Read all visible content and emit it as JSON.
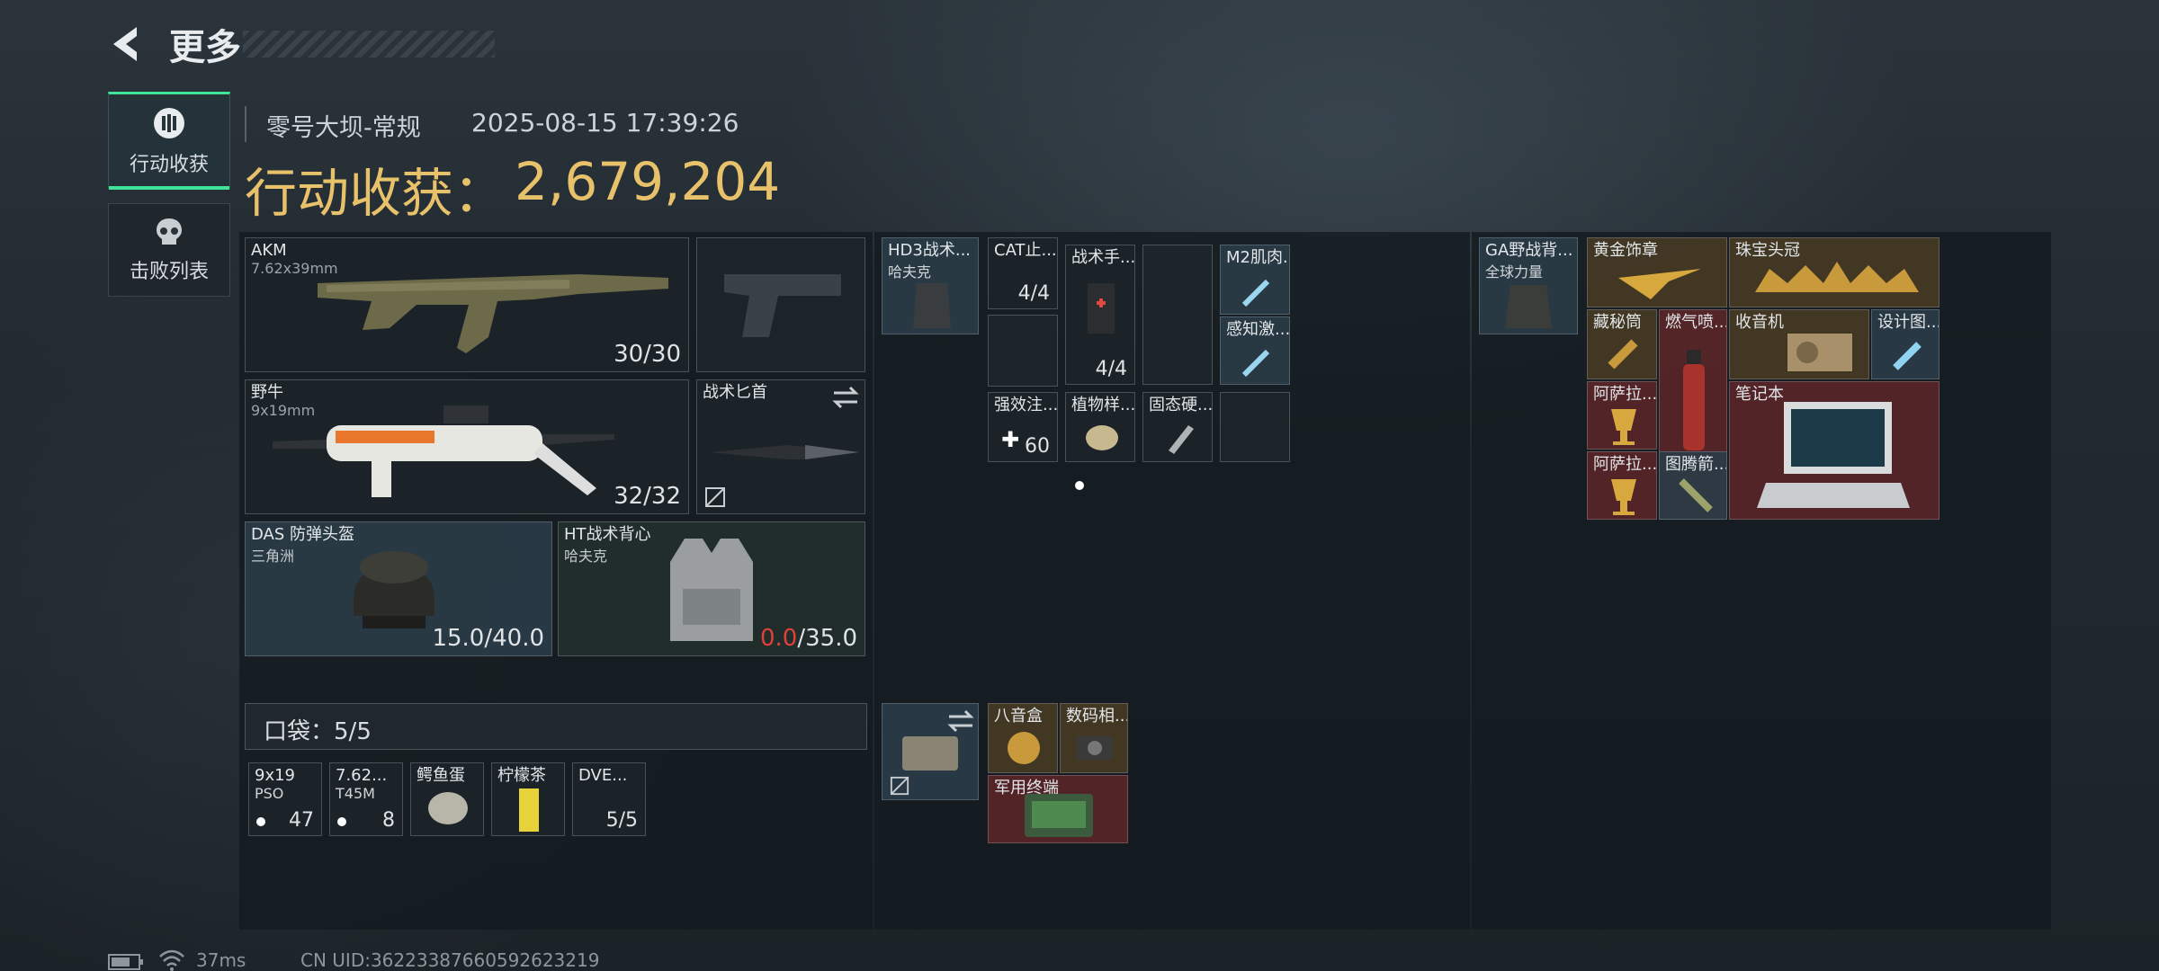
{
  "header": {
    "title": "更多"
  },
  "tabs": [
    {
      "label": "行动收获",
      "icon": "loot-icon",
      "active": true
    },
    {
      "label": "击败列表",
      "icon": "skull-icon",
      "active": false
    }
  ],
  "match": {
    "map": "零号大坝-常规",
    "datetime": "2025-08-15 17:39:26"
  },
  "haul": {
    "label": "行动收获：",
    "value": "2,679,204"
  },
  "weapons": [
    {
      "name": "AKM",
      "caliber": "7.62x39mm",
      "ammo": "30/30"
    },
    {
      "name": "野牛",
      "caliber": "9x19mm",
      "ammo": "32/32"
    }
  ],
  "melee": {
    "name": "战术匕首"
  },
  "helmet": {
    "name": "DAS 防弹头盔",
    "brand": "三角洲",
    "durability": "15.0/40.0"
  },
  "armor": {
    "name": "HT战术背心",
    "brand": "哈夫克",
    "durability_current": "0.0",
    "durability_max": "/35.0"
  },
  "pocket": {
    "label": "口袋：",
    "count": "5/5"
  },
  "pocket_items": [
    {
      "name": "9x19",
      "sub": "PSO",
      "count": "47"
    },
    {
      "name": "7.62...",
      "sub": "T45M",
      "count": "8"
    },
    {
      "name": "鳄鱼蛋",
      "sub": "",
      "count": ""
    },
    {
      "name": "柠檬茶",
      "sub": "",
      "count": ""
    },
    {
      "name": "DVE...",
      "sub": "",
      "count": "5/5"
    }
  ],
  "rig": {
    "name": "HD3战术...",
    "brand": "哈夫克"
  },
  "rig_items": [
    {
      "name": "CAT止...",
      "count": "4/4"
    },
    {
      "name": "战术手...",
      "count": "4/4"
    },
    {
      "name": "M2肌肉...",
      "count": ""
    },
    {
      "name": "感知激...",
      "count": ""
    },
    {
      "name": "强效注...",
      "count": "60"
    },
    {
      "name": "植物样...",
      "count": ""
    },
    {
      "name": "固态硬...",
      "count": ""
    }
  ],
  "case_items": [
    {
      "name": "八音盒"
    },
    {
      "name": "数码相..."
    },
    {
      "name": "军用终端"
    }
  ],
  "backpack": {
    "name": "GA野战背...",
    "brand": "全球力量"
  },
  "backpack_items": [
    {
      "name": "黄金饰章"
    },
    {
      "name": "珠宝头冠"
    },
    {
      "name": "藏秘筒"
    },
    {
      "name": "燃气喷..."
    },
    {
      "name": "收音机"
    },
    {
      "name": "设计图..."
    },
    {
      "name": "阿萨拉..."
    },
    {
      "name": "笔记本"
    },
    {
      "name": "阿萨拉..."
    },
    {
      "name": "图腾箭..."
    }
  ],
  "footer": {
    "ping": "37ms",
    "uid": "CN UID:3622338766059262321​9"
  },
  "colors": {
    "accent": "#3fe39a",
    "haul": "#e8c26a",
    "warning": "#e0403a"
  }
}
